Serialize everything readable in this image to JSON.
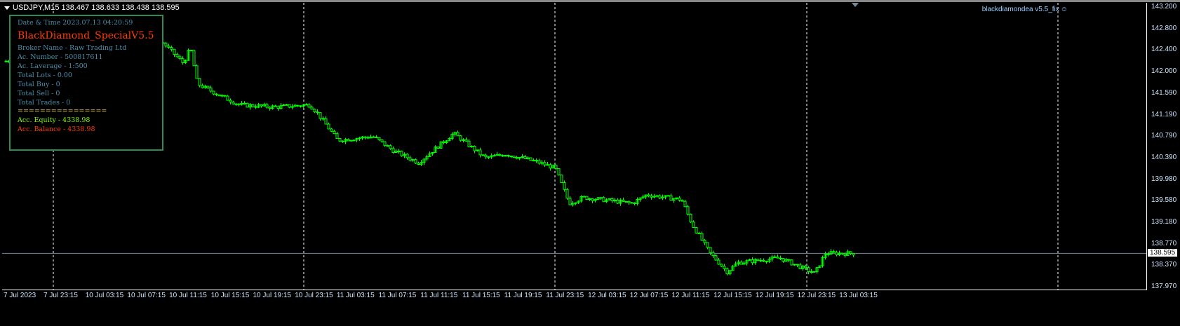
{
  "header": {
    "symbol": "USDJPY,M15",
    "ohlc": "138.467 138.633 138.438 138.595"
  },
  "ea_label": "blackdiamondea  v5.5_fix",
  "panel": {
    "datetime": "Date & Time 2023.07.13 04:20:59",
    "title": "BlackDiamond_SpecialV5.5",
    "broker": "Broker Name - Raw Trading Ltd",
    "account": "Ac. Number - 500817611",
    "leverage": "Ac. Laverage - 1:500",
    "lots": "Total Lots - 0.00",
    "buy": "Total Buy - 0",
    "sell": "Total Sell - 0",
    "trades": "Total Trades - 0",
    "separator": "================",
    "equity": "Acc. Equity - 4338.98",
    "balance": "Acc. Balance - 4338.98"
  },
  "colors": {
    "text": "#4a8eaa",
    "title": "#ff3a00",
    "separator": "#e8d27a",
    "equity": "#7cfc00",
    "balance": "#ff3a00",
    "candle": "#00ff00",
    "border": "#2e8b57"
  },
  "price_axis": [
    "143.200",
    "142.800",
    "142.400",
    "142.000",
    "141.590",
    "141.190",
    "140.790",
    "140.390",
    "139.980",
    "139.580",
    "139.180",
    "138.770",
    "138.370",
    "137.970"
  ],
  "bid": "138.595",
  "time_axis": [
    "7 Jul 2023",
    "7 Jul 23:15",
    "10 Jul 03:15",
    "10 Jul 07:15",
    "10 Jul 11:15",
    "10 Jul 15:15",
    "10 Jul 19:15",
    "10 Jul 23:15",
    "11 Jul 03:15",
    "11 Jul 07:15",
    "11 Jul 11:15",
    "11 Jul 15:15",
    "11 Jul 19:15",
    "11 Jul 23:15",
    "12 Jul 03:15",
    "12 Jul 07:15",
    "12 Jul 11:15",
    "12 Jul 15:15",
    "12 Jul 19:15",
    "12 Jul 23:15",
    "13 Jul 03:15"
  ],
  "chart_data": {
    "type": "candlestick",
    "ylim": [
      137.97,
      143.2
    ],
    "price_path": [
      [
        0,
        142.18
      ],
      [
        52,
        142.3
      ],
      [
        70,
        142.4
      ],
      [
        55,
        142.44
      ],
      [
        50,
        142.54
      ],
      [
        30,
        142.15
      ],
      [
        10,
        142.44
      ],
      [
        10,
        141.76
      ],
      [
        30,
        141.56
      ],
      [
        30,
        141.37
      ],
      [
        50,
        141.33
      ],
      [
        50,
        141.37
      ],
      [
        10,
        141.23
      ],
      [
        30,
        140.71
      ],
      [
        50,
        140.78
      ],
      [
        30,
        140.51
      ],
      [
        35,
        140.29
      ],
      [
        50,
        140.84
      ],
      [
        45,
        140.38
      ],
      [
        30,
        140.45
      ],
      [
        40,
        140.32
      ],
      [
        30,
        140.19
      ],
      [
        20,
        139.53
      ],
      [
        20,
        139.64
      ],
      [
        70,
        139.53
      ],
      [
        20,
        139.69
      ],
      [
        50,
        139.6
      ],
      [
        15,
        139.14
      ],
      [
        25,
        138.61
      ],
      [
        25,
        138.25
      ],
      [
        15,
        138.42
      ],
      [
        60,
        138.51
      ],
      [
        50,
        138.22
      ],
      [
        15,
        138.595
      ]
    ]
  }
}
